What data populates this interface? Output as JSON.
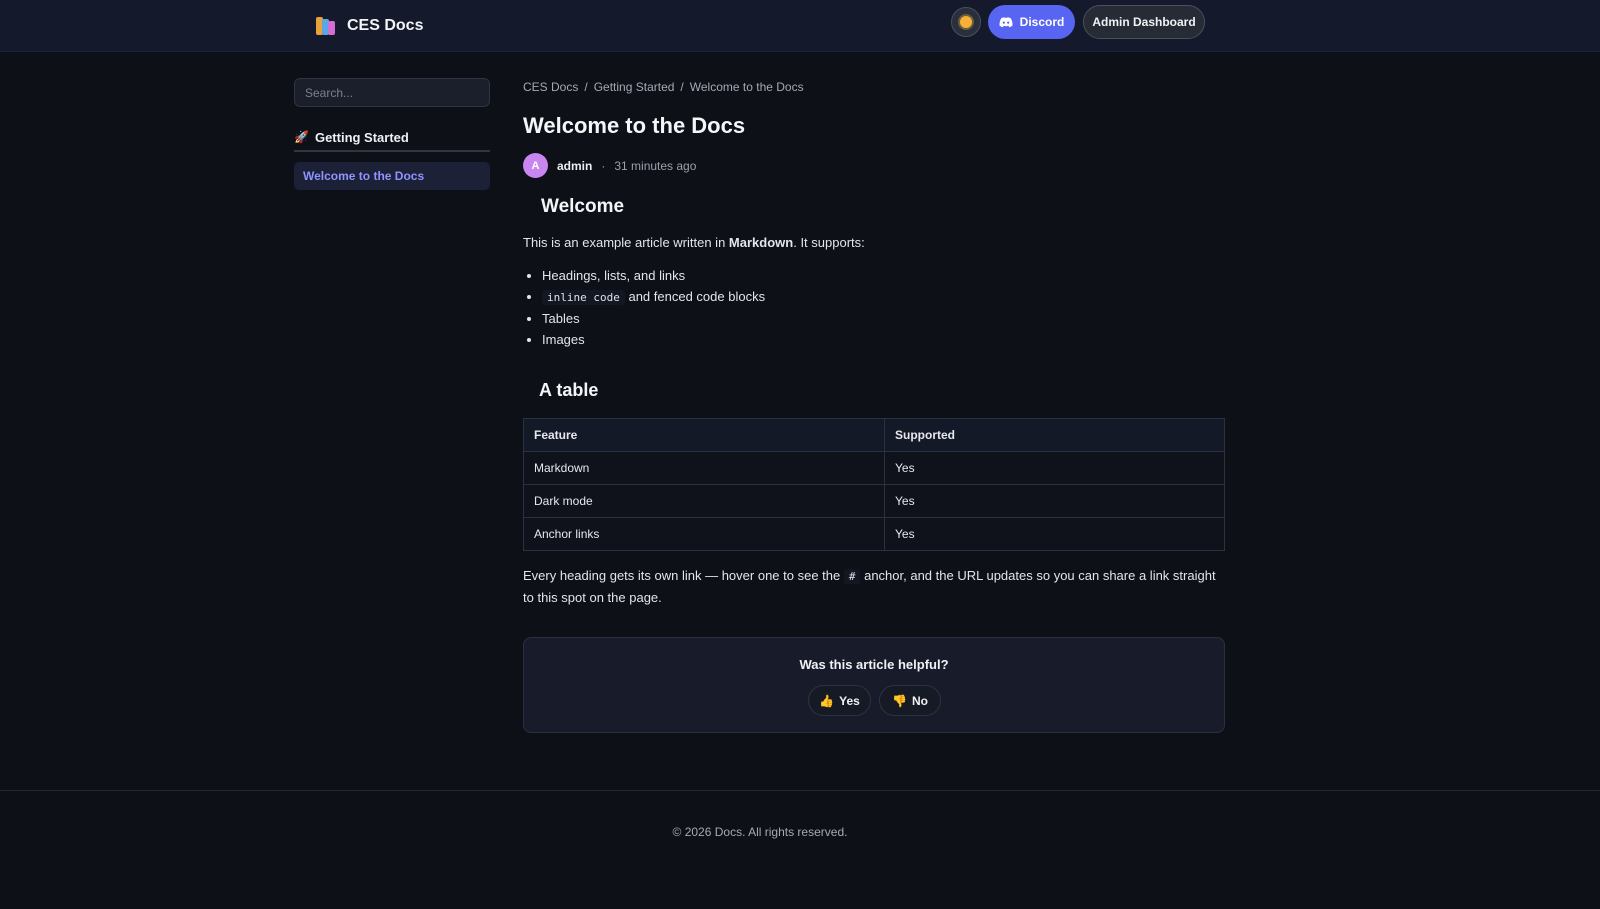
{
  "header": {
    "brand_name": "CES Docs",
    "discord_label": "Discord",
    "admin_label": "Admin Dashboard",
    "theme_icon": "sun-icon",
    "colors": {
      "discord": "#5865f2",
      "header_bg": "#141a2b"
    }
  },
  "sidebar": {
    "search_placeholder": "Search...",
    "category": {
      "icon": "rocket-icon",
      "label": "Getting Started"
    },
    "items": [
      {
        "label": "Welcome to the Docs",
        "active": true
      }
    ]
  },
  "breadcrumb": [
    "CES Docs",
    "Getting Started",
    "Welcome to the Docs"
  ],
  "breadcrumb_separator": "/",
  "article": {
    "title": "Welcome to the Docs",
    "author_initial": "A",
    "author": "admin",
    "meta_separator": "·",
    "time": "31 minutes ago",
    "h_welcome": "Welcome",
    "intro_before": "This is an example article written in ",
    "intro_bold": "Markdown",
    "intro_after": ". It supports:",
    "list": {
      "item1": "Headings, lists, and links",
      "item2_code": "inline code",
      "item2_rest": " and fenced code blocks",
      "item3": "Tables",
      "item4": "Images"
    },
    "h_table": "A table",
    "table": {
      "headers": [
        "Feature",
        "Supported"
      ],
      "rows": [
        [
          "Markdown",
          "Yes"
        ],
        [
          "Dark mode",
          "Yes"
        ],
        [
          "Anchor links",
          "Yes"
        ]
      ]
    },
    "closing_before": "Every heading gets its own link — hover one to see the ",
    "closing_code": "#",
    "closing_after": " anchor, and the URL updates so you can share a link straight to this spot on the page."
  },
  "feedback": {
    "question": "Was this article helpful?",
    "yes_icon": "thumbs-up-icon",
    "yes_label": "Yes",
    "no_icon": "thumbs-down-icon",
    "no_label": "No"
  },
  "footer": {
    "copyright": "© 2026 Docs. All rights reserved."
  }
}
